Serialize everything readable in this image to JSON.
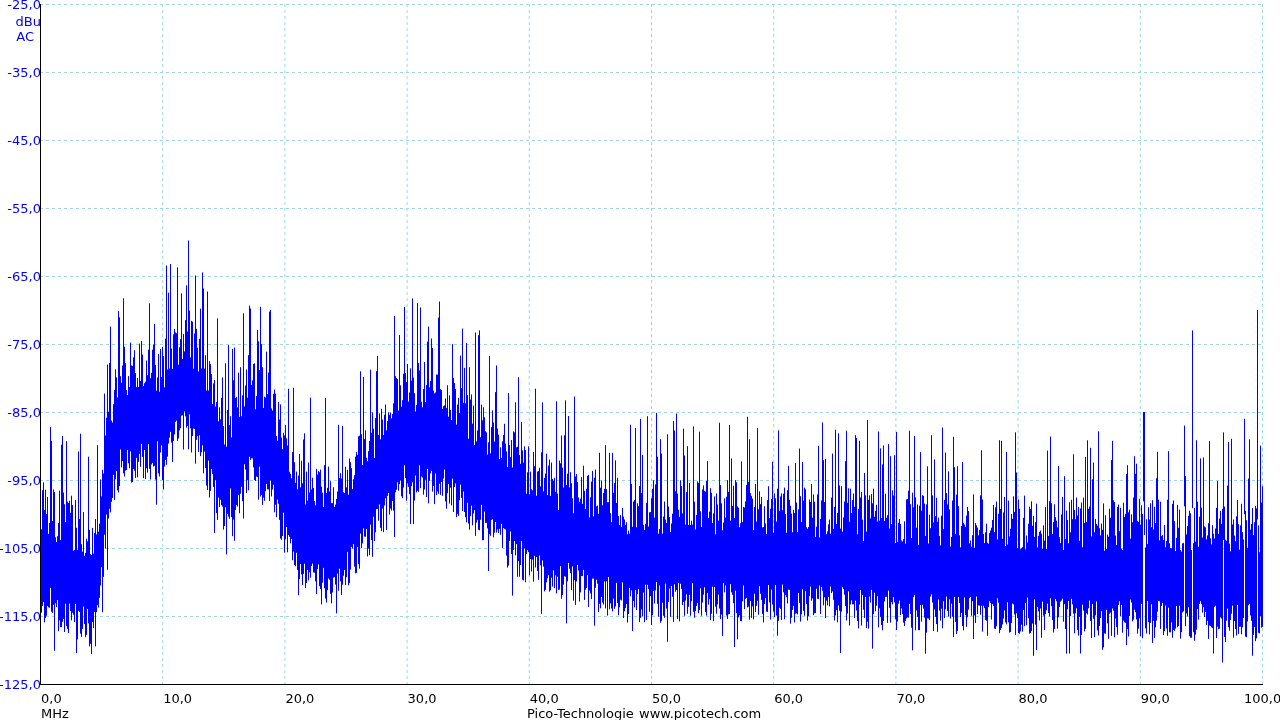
{
  "chart": {
    "y_unit": "dBu",
    "coupling": "AC",
    "x_unit": "MHz",
    "y_tick_labels": [
      "-25,0",
      "-35,0",
      "-45,0",
      "-55,0",
      "-65,0",
      "-75,0",
      "-85,0",
      "-95,0",
      "-105,0",
      "-115,0",
      "-125,0"
    ],
    "x_tick_labels": [
      "0,0",
      "10,0",
      "20,0",
      "30,0",
      "40,0",
      "50,0",
      "60,0",
      "70,0",
      "80,0",
      "90,0",
      "100,0"
    ],
    "footer_company": "Pico-Technologie",
    "footer_url": "www.picotech.com"
  }
}
